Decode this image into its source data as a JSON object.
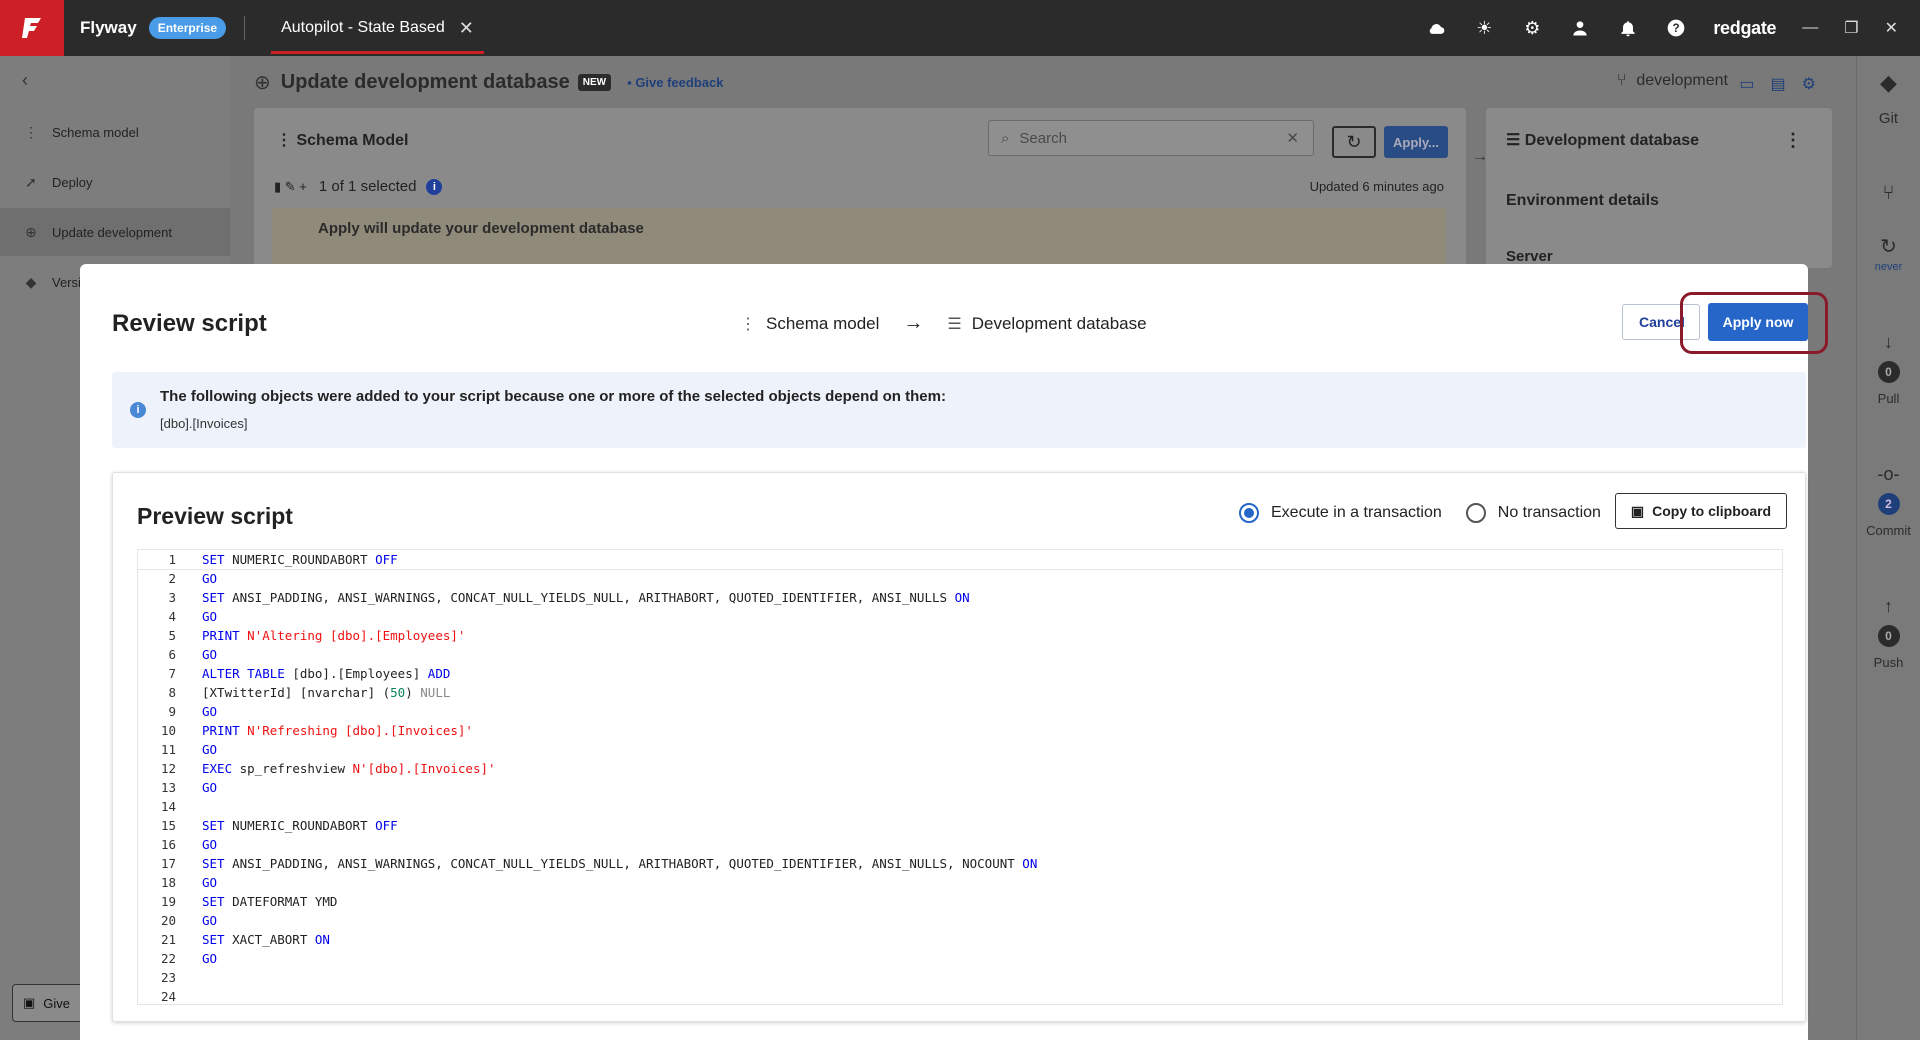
{
  "topbar": {
    "app_name": "Flyway",
    "edition": "Enterprise",
    "tab_title": "Autopilot - State Based",
    "brand": "redgate"
  },
  "leftnav": {
    "items": [
      {
        "label": "Schema model",
        "icon": "schema-icon"
      },
      {
        "label": "Deploy",
        "icon": "rocket-icon"
      },
      {
        "label": "Update development",
        "icon": "update-icon"
      },
      {
        "label": "Versi",
        "icon": "git-icon"
      }
    ],
    "give_label": "Give"
  },
  "main": {
    "title": "Update development database",
    "new_badge": "NEW",
    "feedback": "Give feedback",
    "branch": "development",
    "schema_panel": {
      "title": "Schema Model",
      "search_placeholder": "Search",
      "apply_label": "Apply...",
      "selected": "1 of 1 selected",
      "updated": "Updated 6 minutes ago",
      "warning": "Apply will update your development database"
    },
    "devdb_panel": {
      "title": "Development database",
      "env_details": "Environment details",
      "server": "Server"
    }
  },
  "rightrail": {
    "git": "Git",
    "never": "never",
    "pull_label": "Pull",
    "pull_count": "0",
    "commit_label": "Commit",
    "commit_count": "2",
    "push_label": "Push",
    "push_count": "0"
  },
  "modal": {
    "title": "Review script",
    "from": "Schema model",
    "to": "Development database",
    "cancel": "Cancel",
    "apply_now": "Apply now",
    "info_text": "The following objects were added to your script because one or more of the selected objects depend on them:",
    "info_objects": "[dbo].[Invoices]",
    "preview_title": "Preview script",
    "radio_tx": "Execute in a transaction",
    "radio_notx": "No transaction",
    "copy": "Copy to clipboard"
  },
  "script_lines": [
    [
      {
        "t": "SET",
        "c": "kw"
      },
      {
        "t": " NUMERIC_ROUNDABORT "
      },
      {
        "t": "OFF",
        "c": "kw"
      }
    ],
    [
      {
        "t": "GO",
        "c": "kw"
      }
    ],
    [
      {
        "t": "SET",
        "c": "kw"
      },
      {
        "t": " ANSI_PADDING, ANSI_WARNINGS, CONCAT_NULL_YIELDS_NULL, ARITHABORT, QUOTED_IDENTIFIER, ANSI_NULLS "
      },
      {
        "t": "ON",
        "c": "kw"
      }
    ],
    [
      {
        "t": "GO",
        "c": "kw"
      }
    ],
    [
      {
        "t": "PRINT",
        "c": "kw"
      },
      {
        "t": " "
      },
      {
        "t": "N'Altering [dbo].[Employees]'",
        "c": "str"
      }
    ],
    [
      {
        "t": "GO",
        "c": "kw"
      }
    ],
    [
      {
        "t": "ALTER TABLE",
        "c": "kw"
      },
      {
        "t": " [dbo].[Employees] "
      },
      {
        "t": "ADD",
        "c": "kw"
      }
    ],
    [
      {
        "t": "[XTwitterId] [nvarchar] ("
      },
      {
        "t": "50",
        "c": "num"
      },
      {
        "t": ") "
      },
      {
        "t": "NULL",
        "c": "gray"
      }
    ],
    [
      {
        "t": "GO",
        "c": "kw"
      }
    ],
    [
      {
        "t": "PRINT",
        "c": "kw"
      },
      {
        "t": " "
      },
      {
        "t": "N'Refreshing [dbo].[Invoices]'",
        "c": "str"
      }
    ],
    [
      {
        "t": "GO",
        "c": "kw"
      }
    ],
    [
      {
        "t": "EXEC",
        "c": "kw"
      },
      {
        "t": " sp_refreshview "
      },
      {
        "t": "N'[dbo].[Invoices]'",
        "c": "str"
      }
    ],
    [
      {
        "t": "GO",
        "c": "kw"
      }
    ],
    [],
    [
      {
        "t": "SET",
        "c": "kw"
      },
      {
        "t": " NUMERIC_ROUNDABORT "
      },
      {
        "t": "OFF",
        "c": "kw"
      }
    ],
    [
      {
        "t": "GO",
        "c": "kw"
      }
    ],
    [
      {
        "t": "SET",
        "c": "kw"
      },
      {
        "t": " ANSI_PADDING, ANSI_WARNINGS, CONCAT_NULL_YIELDS_NULL, ARITHABORT, QUOTED_IDENTIFIER, ANSI_NULLS, NOCOUNT "
      },
      {
        "t": "ON",
        "c": "kw"
      }
    ],
    [
      {
        "t": "GO",
        "c": "kw"
      }
    ],
    [
      {
        "t": "SET",
        "c": "kw"
      },
      {
        "t": " DATEFORMAT YMD"
      }
    ],
    [
      {
        "t": "GO",
        "c": "kw"
      }
    ],
    [
      {
        "t": "SET",
        "c": "kw"
      },
      {
        "t": " XACT_ABORT "
      },
      {
        "t": "ON",
        "c": "kw"
      }
    ],
    [
      {
        "t": "GO",
        "c": "kw"
      }
    ],
    [],
    []
  ]
}
